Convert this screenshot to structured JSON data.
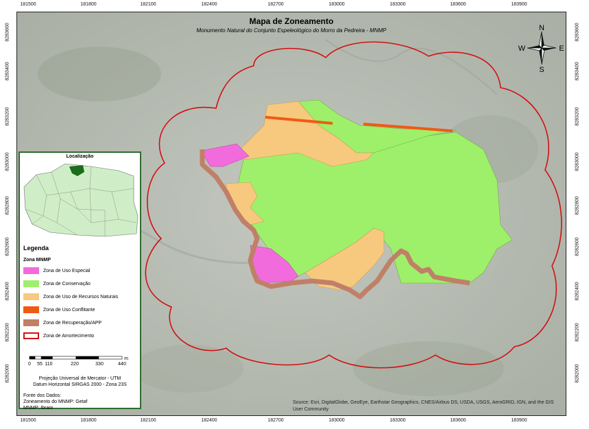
{
  "map": {
    "title": "Mapa de Zoneamento",
    "subtitle": "Monumento Natural do Conjunto Espeleológico do Morro da Pedreira - MNMP",
    "x_ticks": [
      "181500",
      "181800",
      "182100",
      "182400",
      "182700",
      "183000",
      "183300",
      "183600",
      "183900"
    ],
    "y_ticks": [
      "8283600",
      "8283400",
      "8283200",
      "8283000",
      "8282800",
      "8282600",
      "8282400",
      "8282200",
      "8282000"
    ],
    "source_text": "Source: Esri, DigitalGlobe, GeoEye, Earthstar Geographics, CNES/Airbus DS, USDA, USGS, AeroGRID, IGN, and the GIS User Community"
  },
  "compass": {
    "n": "N",
    "s": "S",
    "e": "E",
    "w": "W"
  },
  "legend": {
    "location_title": "Localização",
    "title": "Legenda",
    "subtitle": "Zona MNMP",
    "items": [
      {
        "label": "Zona de Uso Especial",
        "color": "#f26bdd",
        "style": "fill"
      },
      {
        "label": "Zona de Conservação",
        "color": "#9ef06a",
        "style": "fill"
      },
      {
        "label": "Zona de Uso de Recursos Naturais",
        "color": "#f7c97e",
        "style": "fill"
      },
      {
        "label": "Zona de Uso Conflitante",
        "color": "#f05a14",
        "style": "fill"
      },
      {
        "label": "Zona de Recuperação/APP",
        "color": "#c08068",
        "style": "fill"
      },
      {
        "label": "Zona de Amortecimento",
        "color": "#d01010",
        "style": "outline"
      }
    ],
    "scale": {
      "labels": [
        "0",
        "55",
        "110",
        "220",
        "330",
        "440"
      ],
      "unit": "m"
    },
    "projection": [
      "Projeção Universal de Mercator - UTM",
      "Datum Horizontal SIRGAS 2000 - Zona 23S"
    ],
    "sources": [
      "Fonte dos Dados:",
      "Zoneamento do MNMP: Getaf",
      "MNMP: Ibram"
    ]
  }
}
